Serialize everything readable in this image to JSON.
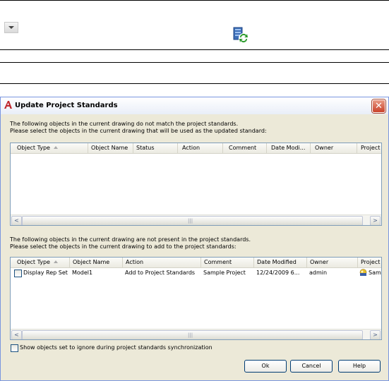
{
  "dialog": {
    "title": "Update Project Standards",
    "mismatch_text_1": "The following objects in the current drawing do not match the project standards.",
    "mismatch_text_2": "Please select the objects in the current drawing that will be used as the updated standard:",
    "missing_text_1": "The following objects in the current drawing are not present in the project standards.",
    "missing_text_2": "Please select the objects in the current drawing to add to the project standards:",
    "ignore_checkbox_label": "Show objects set to ignore during project standards synchronization",
    "ok_label": "Ok",
    "cancel_label": "Cancel",
    "help_label": "Help"
  },
  "top_list": {
    "columns": [
      "Object Type",
      "Object Name",
      "Status",
      "Action",
      "Comment",
      "Date Modi...",
      "Owner",
      "Project"
    ],
    "rows": []
  },
  "bottom_list": {
    "columns": [
      "Object Type",
      "Object Name",
      "Action",
      "Comment",
      "Date Modified",
      "Owner",
      "Project"
    ],
    "rows": [
      {
        "checked": false,
        "object_type": "Display Rep Set",
        "object_name": "Model1",
        "action": "Add to Project Standards",
        "comment": "Sample Project",
        "date_modified": "12/24/2009 6...",
        "owner": "admin",
        "project": "Samp"
      }
    ]
  },
  "scroll_grip": "|||",
  "icons": {
    "dropdown": "chevron-down-icon",
    "standards": "standards-sync-icon",
    "app": "autocad-icon",
    "close": "close-icon",
    "project": "project-icon"
  },
  "close_glyph": "✕"
}
